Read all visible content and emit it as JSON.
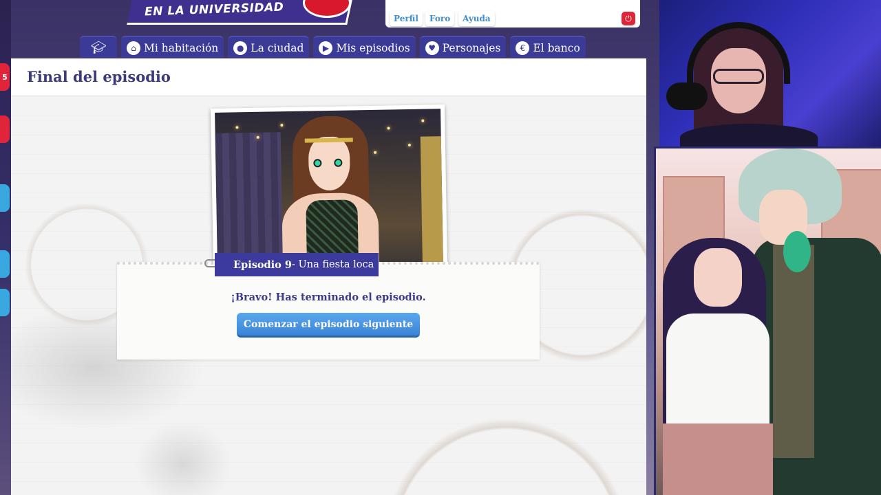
{
  "header": {
    "logo_text": "EN LA UNIVERSIDAD",
    "links": {
      "profile": "Perfil",
      "forum": "Foro",
      "help": "Ayuda"
    },
    "logout_icon": "power-icon"
  },
  "nav": {
    "home_icon": "graduation-cap-icon",
    "items": [
      {
        "label": "Mi habitación",
        "icon": "room-icon"
      },
      {
        "label": "La ciudad",
        "icon": "map-pin-icon"
      },
      {
        "label": "Mis episodios",
        "icon": "play-icon"
      },
      {
        "label": "Personajes",
        "icon": "heart-icon"
      },
      {
        "label": "El banco",
        "icon": "coin-icon"
      }
    ]
  },
  "panel": {
    "title": "Final del episodio",
    "episode_number": "Episodio 9",
    "episode_name": " - Una fiesta loca",
    "message": "¡Bravo! Has terminado el episodio.",
    "next_button": "Comenzar el episodio siguiente"
  },
  "left_strip": {
    "badge_text": "5"
  },
  "colors": {
    "nav_bg": "#3b3a96",
    "title": "#3b3a7a",
    "button": "#3a84d6",
    "link": "#3f8fd0",
    "logout": "#e0243a"
  }
}
